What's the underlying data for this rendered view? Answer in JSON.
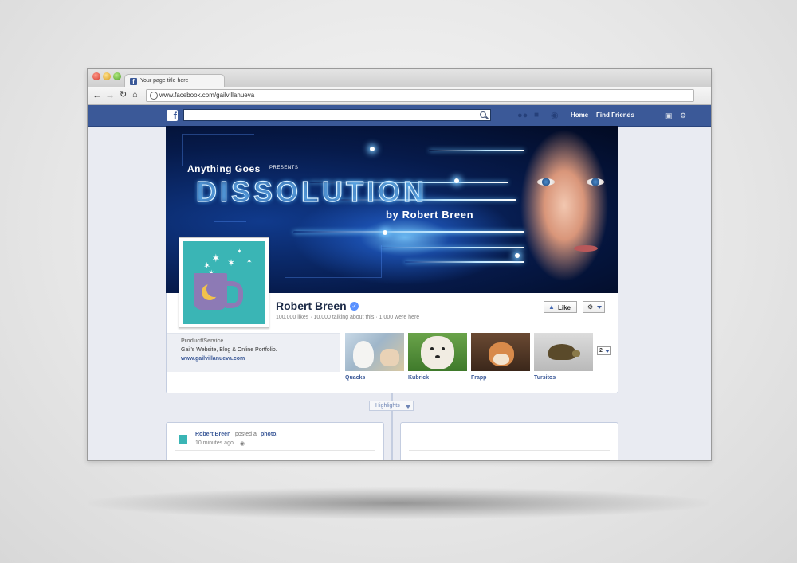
{
  "browser": {
    "tab_title": "Your page title here",
    "url": "www.facebook.com/gailvillanueva"
  },
  "fb_nav": {
    "home": "Home",
    "find_friends": "Find Friends"
  },
  "cover": {
    "presenter": "Anything Goes",
    "presents": "PRESENTS",
    "title": "DISSOLUTION",
    "byline": "by Robert Breen"
  },
  "page": {
    "name": "Robert Breen",
    "stats": "100,000 likes · 10,000 talking about this · 1,000 were here",
    "like_label": "Like",
    "category": "Product/Service",
    "description": "Gail's Website, Blog & Online Portfolio.",
    "website": "www.gailvillanueva.com",
    "more_count": "2"
  },
  "apps": [
    {
      "label": "Quacks",
      "icon": "duck-photo"
    },
    {
      "label": "Kubrick",
      "icon": "dog-photo"
    },
    {
      "label": "Frapp",
      "icon": "hamster-photo"
    },
    {
      "label": "Tursitos",
      "icon": "turtle-photo"
    }
  ],
  "timeline": {
    "highlights_label": "Highlights",
    "post_author": "Robert Breen",
    "post_verb": "posted a",
    "post_object": "photo.",
    "post_time": "10 minutes ago"
  },
  "colors": {
    "facebook_blue": "#3b5998",
    "profile_teal": "#3ab5b5",
    "mug_purple": "#8d7ab5",
    "moon_yellow": "#f2c24c"
  }
}
